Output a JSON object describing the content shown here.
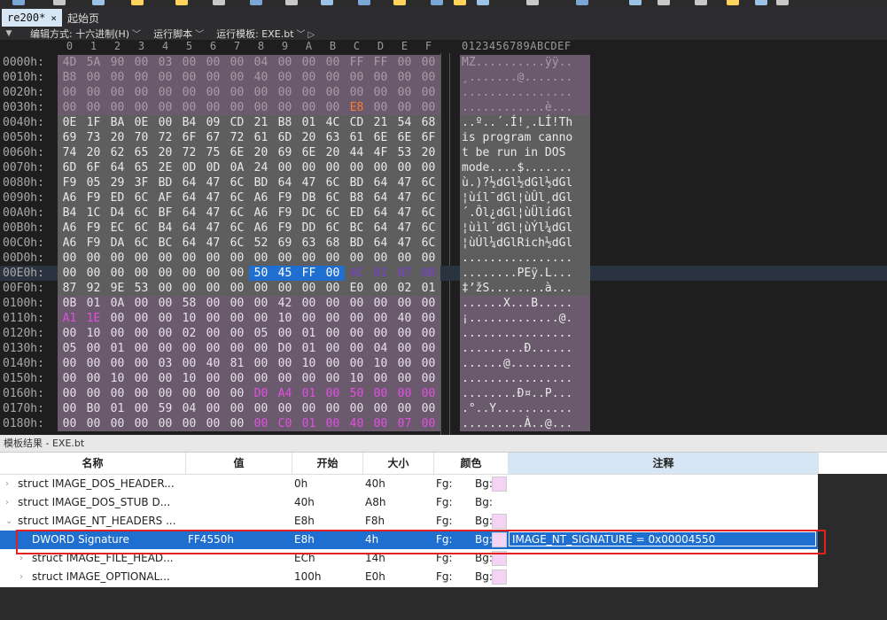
{
  "tabs": {
    "active_label": "re200*",
    "close_glyph": "×",
    "other_label": "起始页"
  },
  "editbar": {
    "edit_as_label": "编辑方式:",
    "edit_as_value": "十六进制(H)",
    "run_script_label": "运行脚本",
    "run_template_label": "运行模板:",
    "run_template_value": "EXE.bt"
  },
  "hex": {
    "column_labels": [
      "0",
      "1",
      "2",
      "3",
      "4",
      "5",
      "6",
      "7",
      "8",
      "9",
      "A",
      "B",
      "C",
      "D",
      "E",
      "F"
    ],
    "ascii_header": "0123456789ABCDEF",
    "rows": [
      {
        "addr": "0000h:",
        "bytes": [
          "4D",
          "5A",
          "90",
          "00",
          "03",
          "00",
          "00",
          "00",
          "04",
          "00",
          "00",
          "00",
          "FF",
          "FF",
          "00",
          "00"
        ],
        "ascii": "MZ..........ÿÿ.."
      },
      {
        "addr": "0010h:",
        "bytes": [
          "B8",
          "00",
          "00",
          "00",
          "00",
          "00",
          "00",
          "00",
          "40",
          "00",
          "00",
          "00",
          "00",
          "00",
          "00",
          "00"
        ],
        "ascii": "¸.......@......."
      },
      {
        "addr": "0020h:",
        "bytes": [
          "00",
          "00",
          "00",
          "00",
          "00",
          "00",
          "00",
          "00",
          "00",
          "00",
          "00",
          "00",
          "00",
          "00",
          "00",
          "00"
        ],
        "ascii": "................"
      },
      {
        "addr": "0030h:",
        "bytes": [
          "00",
          "00",
          "00",
          "00",
          "00",
          "00",
          "00",
          "00",
          "00",
          "00",
          "00",
          "00",
          "E8",
          "00",
          "00",
          "00"
        ],
        "ascii": "............è..."
      },
      {
        "addr": "0040h:",
        "bytes": [
          "0E",
          "1F",
          "BA",
          "0E",
          "00",
          "B4",
          "09",
          "CD",
          "21",
          "B8",
          "01",
          "4C",
          "CD",
          "21",
          "54",
          "68"
        ],
        "ascii": "..º..´.Í!¸.LÍ!Th"
      },
      {
        "addr": "0050h:",
        "bytes": [
          "69",
          "73",
          "20",
          "70",
          "72",
          "6F",
          "67",
          "72",
          "61",
          "6D",
          "20",
          "63",
          "61",
          "6E",
          "6E",
          "6F"
        ],
        "ascii": "is program canno"
      },
      {
        "addr": "0060h:",
        "bytes": [
          "74",
          "20",
          "62",
          "65",
          "20",
          "72",
          "75",
          "6E",
          "20",
          "69",
          "6E",
          "20",
          "44",
          "4F",
          "53",
          "20"
        ],
        "ascii": "t be run in DOS "
      },
      {
        "addr": "0070h:",
        "bytes": [
          "6D",
          "6F",
          "64",
          "65",
          "2E",
          "0D",
          "0D",
          "0A",
          "24",
          "00",
          "00",
          "00",
          "00",
          "00",
          "00",
          "00"
        ],
        "ascii": "mode....$......."
      },
      {
        "addr": "0080h:",
        "bytes": [
          "F9",
          "05",
          "29",
          "3F",
          "BD",
          "64",
          "47",
          "6C",
          "BD",
          "64",
          "47",
          "6C",
          "BD",
          "64",
          "47",
          "6C"
        ],
        "ascii": "ù.)?½dGl½dGl½dGl"
      },
      {
        "addr": "0090h:",
        "bytes": [
          "A6",
          "F9",
          "ED",
          "6C",
          "AF",
          "64",
          "47",
          "6C",
          "A6",
          "F9",
          "DB",
          "6C",
          "B8",
          "64",
          "47",
          "6C"
        ],
        "ascii": "¦ùíl¯dGl¦ùÛl¸dGl"
      },
      {
        "addr": "00A0h:",
        "bytes": [
          "B4",
          "1C",
          "D4",
          "6C",
          "BF",
          "64",
          "47",
          "6C",
          "A6",
          "F9",
          "DC",
          "6C",
          "ED",
          "64",
          "47",
          "6C"
        ],
        "ascii": "´.Ôl¿dGl¦ùÜlídGl"
      },
      {
        "addr": "00B0h:",
        "bytes": [
          "A6",
          "F9",
          "EC",
          "6C",
          "B4",
          "64",
          "47",
          "6C",
          "A6",
          "F9",
          "DD",
          "6C",
          "BC",
          "64",
          "47",
          "6C"
        ],
        "ascii": "¦ùìl´dGl¦ùÝl¼dGl"
      },
      {
        "addr": "00C0h:",
        "bytes": [
          "A6",
          "F9",
          "DA",
          "6C",
          "BC",
          "64",
          "47",
          "6C",
          "52",
          "69",
          "63",
          "68",
          "BD",
          "64",
          "47",
          "6C"
        ],
        "ascii": "¦ùÚl¼dGlRich½dGl"
      },
      {
        "addr": "00D0h:",
        "bytes": [
          "00",
          "00",
          "00",
          "00",
          "00",
          "00",
          "00",
          "00",
          "00",
          "00",
          "00",
          "00",
          "00",
          "00",
          "00",
          "00"
        ],
        "ascii": "................"
      },
      {
        "addr": "00E0h:",
        "bytes": [
          "00",
          "00",
          "00",
          "00",
          "00",
          "00",
          "00",
          "00",
          "50",
          "45",
          "FF",
          "00",
          "4C",
          "01",
          "07",
          "00"
        ],
        "ascii": "........PEÿ.L..."
      },
      {
        "addr": "00F0h:",
        "bytes": [
          "87",
          "92",
          "9E",
          "53",
          "00",
          "00",
          "00",
          "00",
          "00",
          "00",
          "00",
          "00",
          "E0",
          "00",
          "02",
          "01"
        ],
        "ascii": "‡’žS........à..."
      },
      {
        "addr": "0100h:",
        "bytes": [
          "0B",
          "01",
          "0A",
          "00",
          "00",
          "58",
          "00",
          "00",
          "00",
          "42",
          "00",
          "00",
          "00",
          "00",
          "00",
          "00"
        ],
        "ascii": "......X...B....."
      },
      {
        "addr": "0110h:",
        "bytes": [
          "A1",
          "1E",
          "00",
          "00",
          "00",
          "10",
          "00",
          "00",
          "00",
          "10",
          "00",
          "00",
          "00",
          "00",
          "40",
          "00"
        ],
        "ascii": "¡.............@."
      },
      {
        "addr": "0120h:",
        "bytes": [
          "00",
          "10",
          "00",
          "00",
          "00",
          "02",
          "00",
          "00",
          "05",
          "00",
          "01",
          "00",
          "00",
          "00",
          "00",
          "00"
        ],
        "ascii": "................"
      },
      {
        "addr": "0130h:",
        "bytes": [
          "05",
          "00",
          "01",
          "00",
          "00",
          "00",
          "00",
          "00",
          "00",
          "D0",
          "01",
          "00",
          "00",
          "04",
          "00",
          "00"
        ],
        "ascii": ".........Ð......"
      },
      {
        "addr": "0140h:",
        "bytes": [
          "00",
          "00",
          "00",
          "00",
          "03",
          "00",
          "40",
          "81",
          "00",
          "00",
          "10",
          "00",
          "00",
          "10",
          "00",
          "00"
        ],
        "ascii": "......@........."
      },
      {
        "addr": "0150h:",
        "bytes": [
          "00",
          "00",
          "10",
          "00",
          "00",
          "10",
          "00",
          "00",
          "00",
          "00",
          "00",
          "00",
          "10",
          "00",
          "00",
          "00"
        ],
        "ascii": "................"
      },
      {
        "addr": "0160h:",
        "bytes": [
          "00",
          "00",
          "00",
          "00",
          "00",
          "00",
          "00",
          "00",
          "D0",
          "A4",
          "01",
          "00",
          "50",
          "00",
          "00",
          "00"
        ],
        "ascii": "........Ð¤..P..."
      },
      {
        "addr": "0170h:",
        "bytes": [
          "00",
          "B0",
          "01",
          "00",
          "59",
          "04",
          "00",
          "00",
          "00",
          "00",
          "00",
          "00",
          "00",
          "00",
          "00",
          "00"
        ],
        "ascii": ".°..Y..........."
      },
      {
        "addr": "0180h:",
        "bytes": [
          "00",
          "00",
          "00",
          "00",
          "00",
          "00",
          "00",
          "00",
          "00",
          "C0",
          "01",
          "00",
          "40",
          "00",
          "07",
          "00"
        ],
        "ascii": ".........À..@..."
      }
    ]
  },
  "template_pane": {
    "title": "模板结果 - EXE.bt",
    "headers": {
      "name": "名称",
      "value": "值",
      "start": "开始",
      "size": "大小",
      "color": "颜色",
      "comment": "注释"
    },
    "rows": [
      {
        "name": "struct IMAGE_DOS_HEADER...",
        "value": "",
        "start": "0h",
        "size": "40h",
        "fg": "Fg:",
        "bg": "Bg:",
        "comment": "",
        "expander": "›"
      },
      {
        "name": "struct IMAGE_DOS_STUB D...",
        "value": "",
        "start": "40h",
        "size": "A8h",
        "fg": "Fg:",
        "bg": "Bg:",
        "comment": "",
        "expander": "›"
      },
      {
        "name": "struct IMAGE_NT_HEADERS ...",
        "value": "",
        "start": "E8h",
        "size": "F8h",
        "fg": "Fg:",
        "bg": "Bg:",
        "comment": "",
        "expander": "⌄"
      },
      {
        "name": "DWORD Signature",
        "value": "FF4550h",
        "start": "E8h",
        "size": "4h",
        "fg": "Fg:",
        "bg": "Bg:",
        "comment": "IMAGE_NT_SIGNATURE = 0x00004550",
        "expander": ""
      },
      {
        "name": "struct IMAGE_FILE_HEAD...",
        "value": "",
        "start": "ECh",
        "size": "14h",
        "fg": "Fg:",
        "bg": "Bg:",
        "comment": "",
        "expander": "›"
      },
      {
        "name": "struct IMAGE_OPTIONAL...",
        "value": "",
        "start": "100h",
        "size": "E0h",
        "fg": "Fg:",
        "bg": "Bg:",
        "comment": "",
        "expander": "›"
      }
    ]
  },
  "colors": {
    "dos_header_bg": "#6b5a6e",
    "dos_stub_bg": "#5e5e5e",
    "selection_bg": "#1e6fd0",
    "swatch": "#f4d3f4",
    "annotation_box": "#e12020"
  }
}
